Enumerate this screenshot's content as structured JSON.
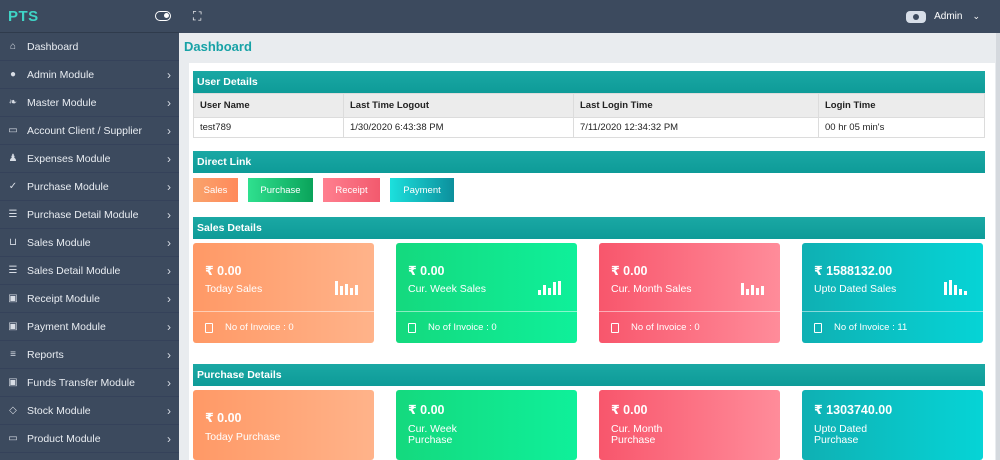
{
  "sidebar": {
    "brand": "PTS",
    "items": [
      {
        "label": "Dashboard",
        "icon": "home-icon",
        "glyph": "⌂",
        "chevron": false
      },
      {
        "label": "Admin Module",
        "icon": "admin-icon",
        "glyph": "●",
        "chevron": true
      },
      {
        "label": "Master Module",
        "icon": "leaf-icon",
        "glyph": "❧",
        "chevron": true
      },
      {
        "label": "Account Client / Supplier",
        "icon": "money-icon",
        "glyph": "▭",
        "chevron": true
      },
      {
        "label": "Expenses Module",
        "icon": "user-icon",
        "glyph": "♟",
        "chevron": true
      },
      {
        "label": "Purchase Module",
        "icon": "check-circle-icon",
        "glyph": "✓",
        "chevron": true
      },
      {
        "label": "Purchase Detail Module",
        "icon": "list-icon",
        "glyph": "☰",
        "chevron": true
      },
      {
        "label": "Sales Module",
        "icon": "cart-icon",
        "glyph": "⊔",
        "chevron": true
      },
      {
        "label": "Sales Detail Module",
        "icon": "list-icon",
        "glyph": "☰",
        "chevron": true
      },
      {
        "label": "Receipt Module",
        "icon": "money-icon",
        "glyph": "▣",
        "chevron": true
      },
      {
        "label": "Payment Module",
        "icon": "money-icon",
        "glyph": "▣",
        "chevron": true
      },
      {
        "label": "Reports",
        "icon": "list-icon",
        "glyph": "≡",
        "chevron": true
      },
      {
        "label": "Funds Transfer Module",
        "icon": "money-icon",
        "glyph": "▣",
        "chevron": true
      },
      {
        "label": "Stock Module",
        "icon": "diamond-icon",
        "glyph": "◇",
        "chevron": true
      },
      {
        "label": "Product Module",
        "icon": "box-icon",
        "glyph": "▭",
        "chevron": true
      }
    ]
  },
  "topbar": {
    "user_name": "Admin"
  },
  "page_title": "Dashboard",
  "user_details": {
    "title": "User Details",
    "columns": [
      "User Name",
      "Last Time Logout",
      "Last Login Time",
      "Login Time"
    ],
    "rows": [
      [
        "test789",
        "1/30/2020 6:43:38 PM",
        "7/11/2020 12:34:32 PM",
        "00 hr 05 min's"
      ]
    ]
  },
  "direct_link": {
    "title": "Direct Link",
    "buttons": [
      "Sales",
      "Purchase",
      "Receipt",
      "Payment"
    ]
  },
  "sales_details": {
    "title": "Sales Details",
    "cards": [
      {
        "amount": "₹ 0.00",
        "caption": "Today Sales",
        "footer": "No of Invoice : 0"
      },
      {
        "amount": "₹ 0.00",
        "caption": "Cur. Week Sales",
        "footer": "No of Invoice : 0"
      },
      {
        "amount": "₹ 0.00",
        "caption": "Cur. Month Sales",
        "footer": "No of Invoice : 0"
      },
      {
        "amount": "₹ 1588132.00",
        "caption": "Upto Dated Sales",
        "footer": "No of Invoice : 11"
      }
    ]
  },
  "purchase_details": {
    "title": "Purchase Details",
    "cards": [
      {
        "amount": "₹ 0.00",
        "caption": "Today Purchase"
      },
      {
        "amount": "₹ 0.00",
        "caption": "Cur. Week Purchase"
      },
      {
        "amount": "₹ 0.00",
        "caption": "Cur. Month Purchase"
      },
      {
        "amount": "₹ 1303740.00",
        "caption": "Upto Dated Purchase"
      }
    ]
  }
}
